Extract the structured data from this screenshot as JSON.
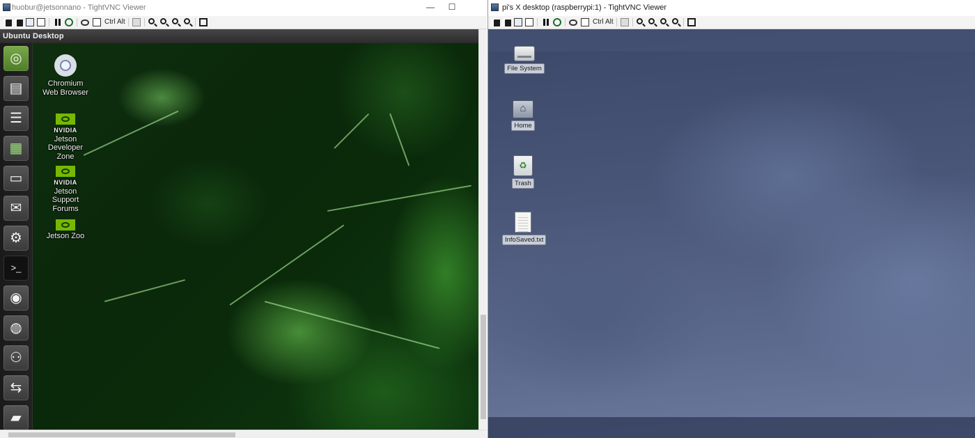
{
  "left_window": {
    "title": "huobur@jetsonnano - TightVNC Viewer",
    "controls": {
      "minimize": "—",
      "maximize": "☐"
    },
    "toolbar": {
      "ctrl_label": "Ctrl",
      "alt_label": "Alt"
    },
    "remote": {
      "topbar_title": "Ubuntu Desktop",
      "launcher": [
        "ubuntu-home",
        "file-manager",
        "writer",
        "calc",
        "impress",
        "software-center",
        "settings",
        "terminal",
        "network",
        "chromium",
        "system-monitor",
        "remote-desktop",
        "drive"
      ],
      "desktop_icons": [
        {
          "name": "chromium",
          "label": "Chromium Web Browser"
        },
        {
          "name": "jetson-developer-zone",
          "brand": "NVIDIA",
          "label": "Jetson Developer Zone"
        },
        {
          "name": "jetson-support-forums",
          "brand": "NVIDIA",
          "label": "Jetson Support Forums"
        },
        {
          "name": "jetson-zoo",
          "brand": "NVIDIA",
          "label": "Jetson Zoo"
        }
      ]
    }
  },
  "right_window": {
    "title": "pi's X desktop (raspberrypi:1) - TightVNC Viewer",
    "toolbar": {
      "ctrl_label": "Ctrl",
      "alt_label": "Alt"
    },
    "remote": {
      "desktop_icons": [
        {
          "name": "file-system",
          "label": "File System"
        },
        {
          "name": "home",
          "label": "Home"
        },
        {
          "name": "trash",
          "label": "Trash"
        },
        {
          "name": "infosaved",
          "label": "InfoSaved.txt"
        }
      ]
    }
  },
  "colors": {
    "ubuntu_accent": "#76b900",
    "lxde_background": "#4a5678"
  }
}
